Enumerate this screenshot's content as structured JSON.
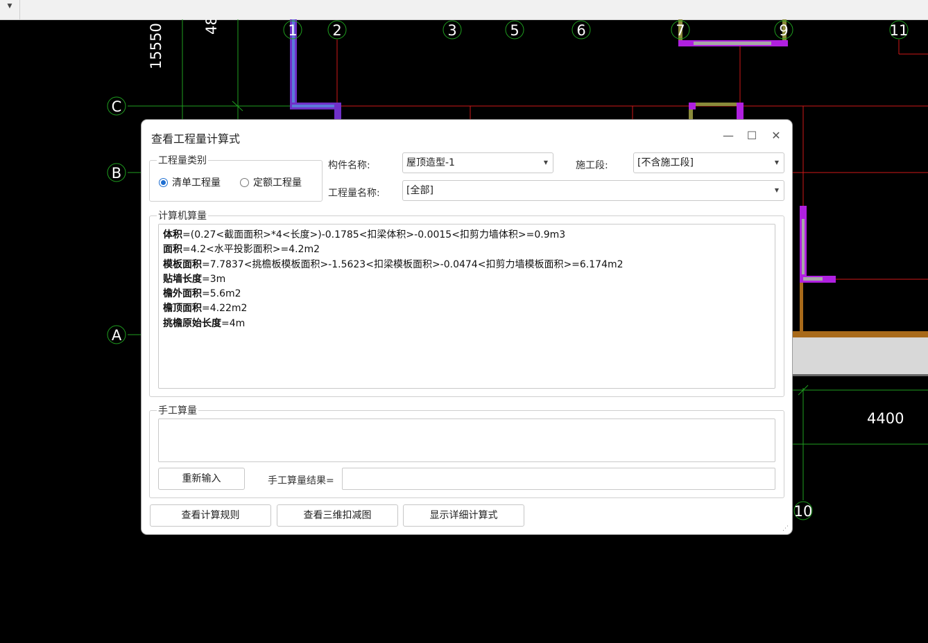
{
  "dialog": {
    "title": "查看工程量计算式",
    "controls": {
      "minimize": "—",
      "maximize": "☐",
      "close": "✕"
    },
    "qty_type": {
      "legend": "工程量类别",
      "options": [
        {
          "label": "清单工程量",
          "selected": true
        },
        {
          "label": "定额工程量",
          "selected": false
        }
      ]
    },
    "component_label": "构件名称:",
    "component_value": "屋顶造型-1",
    "stage_label": "施工段:",
    "stage_value": "[不含施工段]",
    "qty_name_label": "工程量名称:",
    "qty_name_value": "[全部]",
    "computer": {
      "legend": "计算机算量",
      "lines": [
        {
          "name": "体积",
          "expr": "=(0.27<截面面积>*4<长度>)-0.1785<扣梁体积>-0.0015<扣剪力墙体积>=0.9m3"
        },
        {
          "name": "面积",
          "expr": "=4.2<水平投影面积>=4.2m2"
        },
        {
          "name": "模板面积",
          "expr": "=7.7837<挑檐板模板面积>-1.5623<扣梁模板面积>-0.0474<扣剪力墙模板面积>=6.174m2"
        },
        {
          "name": "贴墙长度",
          "expr": "=3m"
        },
        {
          "name": "檐外面积",
          "expr": "=5.6m2"
        },
        {
          "name": "檐顶面积",
          "expr": "=4.22m2"
        },
        {
          "name": "挑檐原始长度",
          "expr": "=4m"
        }
      ]
    },
    "manual": {
      "legend": "手工算量",
      "reinput_label": "重新输入",
      "result_label": "手工算量结果="
    },
    "bottom_buttons": {
      "rules": "查看计算规则",
      "view3d": "查看三维扣减图",
      "detail": "显示详细计算式"
    }
  },
  "cad": {
    "axis_labels": {
      "n1": "1",
      "n2": "2",
      "n3": "3",
      "n5": "5",
      "n6": "6",
      "n7": "7",
      "n9": "9",
      "n10": "10",
      "n11": "11",
      "a": "A",
      "b": "B",
      "c": "C"
    },
    "dimensions": {
      "d15550": "15550",
      "d48": "48",
      "d4400": "4400"
    }
  }
}
